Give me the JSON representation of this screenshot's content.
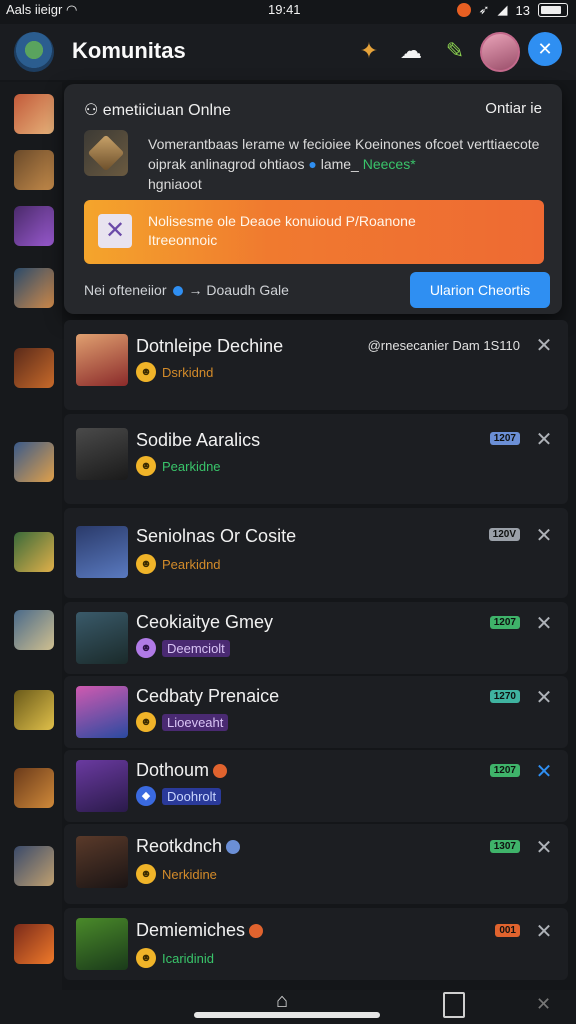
{
  "status_bar": {
    "carrier": "Aals iieigr",
    "time": "19:41",
    "battery": "13"
  },
  "header": {
    "title": "Komunitas"
  },
  "popup": {
    "title": "emetiiciuan Onlne",
    "right_label": "Ontiar ie",
    "description": "Vomerantbaas lerame w fecioiee Koeinones ofcoet verttiaecote oiprak anlinagrod ohtiaos",
    "description_tail": "lame_",
    "description_green": "Neeces*",
    "description_line3": "hgniaoot",
    "banner_text": "Nolisesme ole Deaoe konuioud P/Roanone",
    "banner_subtext": "Itreeonnoic",
    "footer_text": "Nei ofteneiior",
    "footer_text2": "Doaudh Gale",
    "button_label": "Ularion Cheortis"
  },
  "rows": [
    {
      "name": "Dotnleipe Dechine",
      "sub": "Dsrkidnd",
      "sub_color": "#d38b2a",
      "meta": "@rnesecanier Dam 1S110",
      "tag": ""
    },
    {
      "name": "Sodibe Aaralics",
      "sub": "Pearkidne",
      "sub_color": "#39c46a",
      "meta": "",
      "tag": "1207",
      "tag_color": "#6b8fd6"
    },
    {
      "name": "Seniolnas Or Cosite",
      "sub": "Pearkidnd",
      "sub_color": "#d38b2a",
      "meta": "",
      "tag": "120V",
      "tag_color": "#9aa0a8"
    },
    {
      "name": "Ceokiaitye Gmey",
      "sub": "Deemciolt",
      "sub_color": "#b07ae6",
      "meta": "",
      "tag": "1207",
      "tag_color": "#3fb36a"
    },
    {
      "name": "Cedbaty Prenaice",
      "sub": "Lioeveaht",
      "sub_color": "#b07ae6",
      "meta": "",
      "tag": "1270",
      "tag_color": "#3fb3a0"
    },
    {
      "name": "Dothoum",
      "sub": "Doohrolt",
      "sub_color": "#5a8cf0",
      "meta": "",
      "tag": "1207",
      "tag_color": "#3fb36a"
    },
    {
      "name": "Reotkdnch",
      "sub": "Nerkidine",
      "sub_color": "#d38b2a",
      "meta": "",
      "tag": "1307",
      "tag_color": "#3fb36a"
    },
    {
      "name": "Demiemiches",
      "sub": "Icaridinid",
      "sub_color": "#39c46a",
      "meta": "",
      "tag": "001",
      "tag_color": "#e0632e"
    }
  ]
}
